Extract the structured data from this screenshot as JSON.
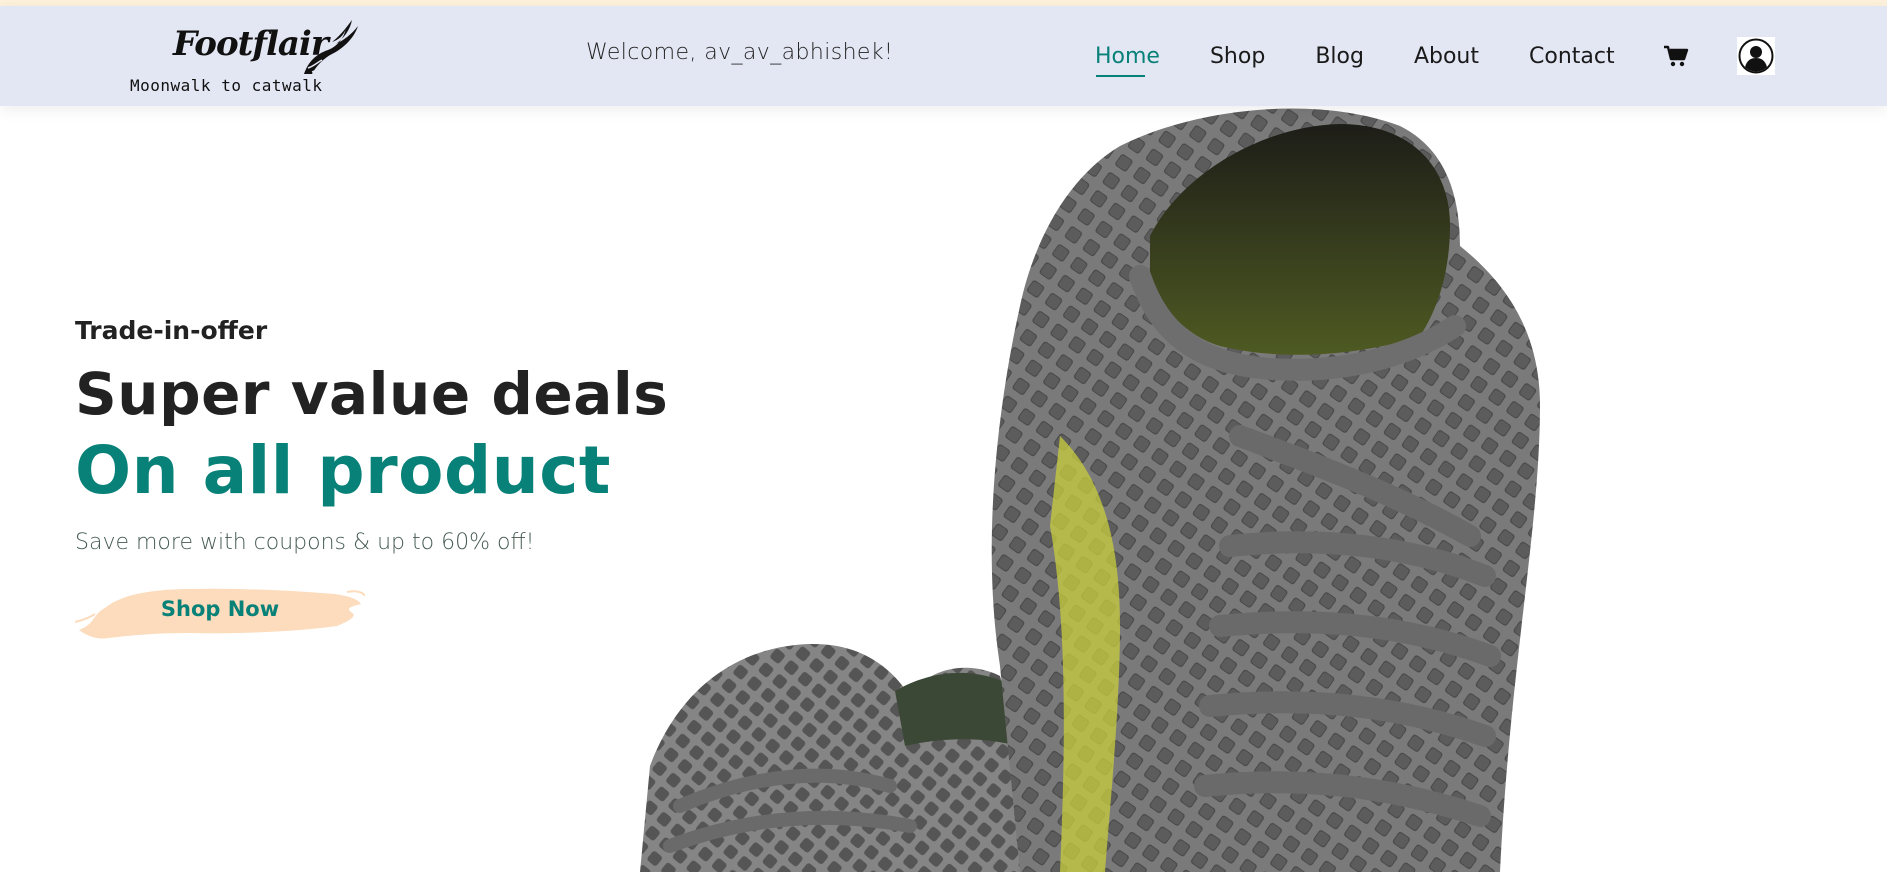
{
  "brand": {
    "name": "Footflair",
    "tagline": "Moonwalk to catwalk",
    "icon": "winged-shoe-icon"
  },
  "header": {
    "welcome": "Welcome, av_av_abhishek!"
  },
  "nav": {
    "items": [
      {
        "label": "Home",
        "active": true
      },
      {
        "label": "Shop"
      },
      {
        "label": "Blog"
      },
      {
        "label": "About"
      },
      {
        "label": "Contact"
      }
    ],
    "cart_icon": "shopping-cart-icon",
    "account_icon": "user-account-icon"
  },
  "hero": {
    "kicker": "Trade-in-offer",
    "title_line1": "Super value deals",
    "title_line2": "On all product",
    "subtitle": "Save more with coupons & up to 60% off!",
    "button_label": "Shop Now",
    "image": "gray-mesh-sneakers-image"
  },
  "colors": {
    "accent": "#088178",
    "header_bg": "#e3e6f3",
    "top_strip": "#fdf1dc",
    "button_brush": "#fcdcbd"
  }
}
